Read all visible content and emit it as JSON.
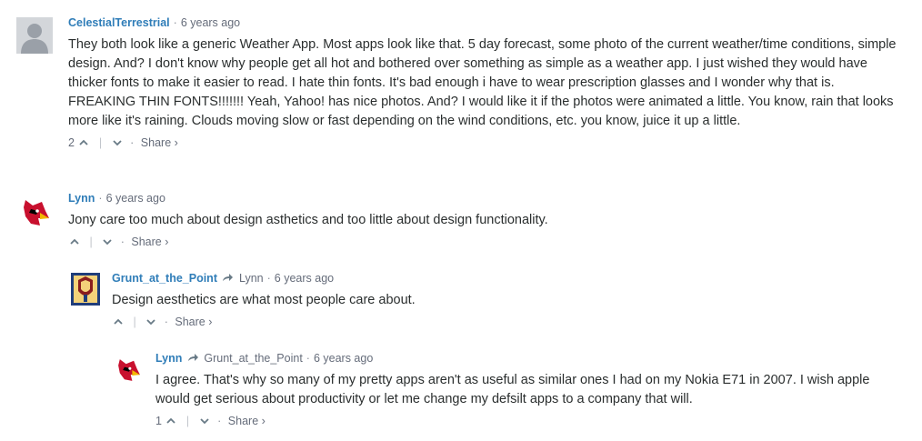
{
  "comments": [
    {
      "author": "CelestialTerrestrial",
      "reply_to": "",
      "time": "6 years ago",
      "text": "They both look like a generic Weather App. Most apps look like that. 5 day forecast, some photo of the current weather/time conditions, simple design. And? I don't know why people get all hot and bothered over something as simple as a weather app. I just wished they would have thicker fonts to make it easier to read. I hate thin fonts. It's bad enough i have to wear prescription glasses and I wonder why that is. FREAKING THIN FONTS!!!!!!! Yeah, Yahoo! has nice photos. And? I would like it if the photos were animated a little. You know, rain that looks more like it's raining. Clouds moving slow or fast depending on the wind conditions, etc. you know, juice it up a little.",
      "upvotes": "2",
      "share": "Share ›",
      "avatar": "default-user-icon"
    },
    {
      "author": "Lynn",
      "reply_to": "",
      "time": "6 years ago",
      "text": "Jony care too much about design asthetics and too little about design functionality.",
      "upvotes": "",
      "share": "Share ›",
      "avatar": "cardinal-icon"
    },
    {
      "author": "Grunt_at_the_Point",
      "reply_to": "Lynn",
      "time": "6 years ago",
      "text": "Design aesthetics are what most people care about.",
      "upvotes": "",
      "share": "Share ›",
      "avatar": "crest-icon"
    },
    {
      "author": "Lynn",
      "reply_to": "Grunt_at_the_Point",
      "time": "6 years ago",
      "text": "I agree. That's why so many of my pretty apps aren't as useful as similar ones I had on my Nokia E71 in 2007. I wish apple would get serious about productivity or let me change my defsilt apps to a company that will.",
      "upvotes": "1",
      "share": "Share ›",
      "avatar": "cardinal-icon"
    }
  ],
  "colors": {
    "author": "#2f7db8",
    "meta": "#656c7a",
    "text": "#2a2e2e"
  }
}
